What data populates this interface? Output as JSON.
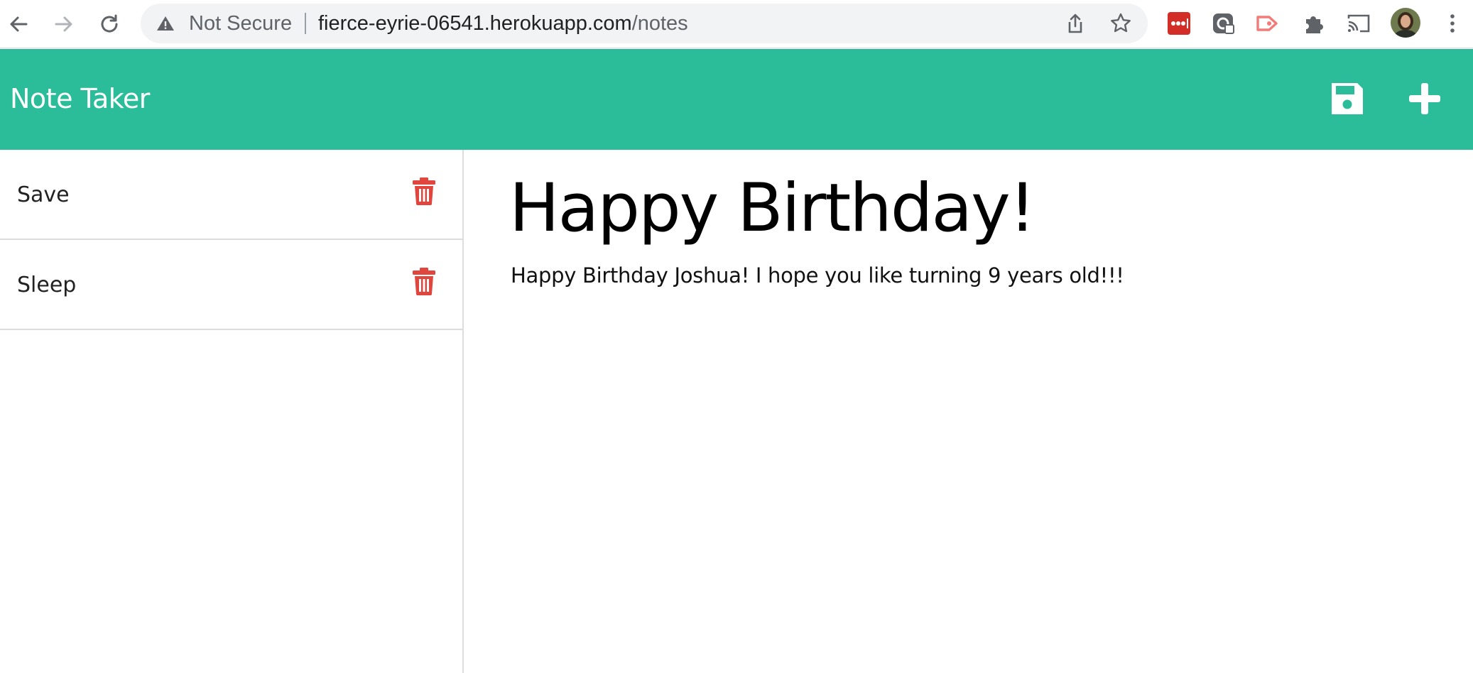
{
  "browser": {
    "security_status": "Not Secure",
    "url_host": "fierce-eyrie-06541.herokuapp.com",
    "url_path": "/notes"
  },
  "app": {
    "title": "Note Taker",
    "colors": {
      "header": "#2bbd9a",
      "trash": "#e0463e"
    }
  },
  "notes": [
    {
      "label": "Save"
    },
    {
      "label": "Sleep"
    }
  ],
  "active_note": {
    "title": "Happy Birthday!",
    "text": "Happy Birthday Joshua! I hope you like turning 9 years old!!!"
  },
  "icons": {
    "back": "back-arrow-icon",
    "forward": "forward-arrow-icon",
    "reload": "reload-icon",
    "warning": "warning-icon",
    "share": "share-icon",
    "bookmark": "star-icon",
    "save": "floppy-disk-icon",
    "new": "plus-icon",
    "delete": "trash-icon"
  }
}
